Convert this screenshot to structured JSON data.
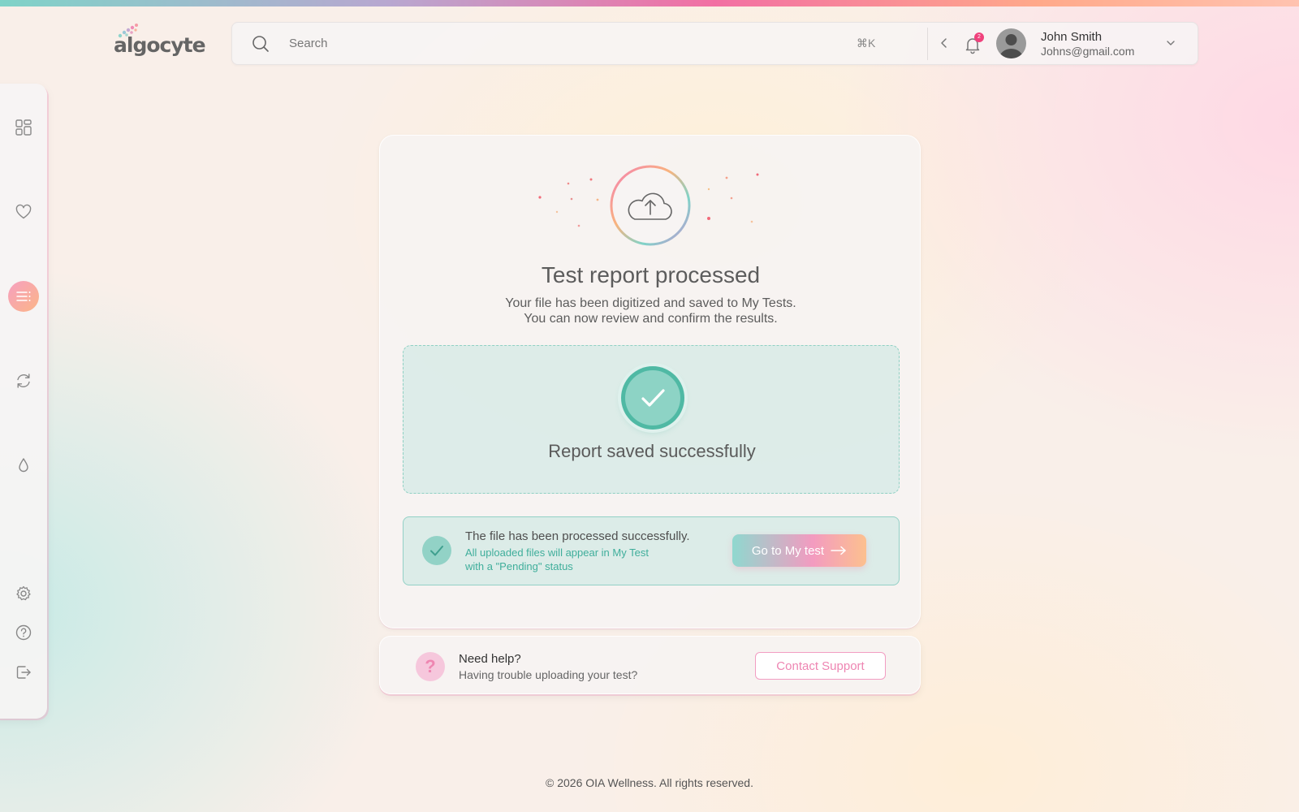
{
  "brand": {
    "name": "algocyte",
    "colors": {
      "teal": "#4fb9a4",
      "pink": "#f26fa3",
      "peach": "#fbb587"
    }
  },
  "header": {
    "search": {
      "placeholder": "Search",
      "shortcut": "⌘K"
    },
    "notifications": {
      "count": "2",
      "icon": "bell-icon"
    },
    "user": {
      "name": "John Smith",
      "email": "Johns@gmail.com"
    }
  },
  "sidebar": {
    "items": [
      {
        "icon": "dashboard-icon",
        "active": false
      },
      {
        "icon": "heart-icon",
        "active": false
      },
      {
        "icon": "tests-list-icon",
        "active": true
      },
      {
        "icon": "refresh-icon",
        "active": false
      },
      {
        "icon": "drop-icon",
        "active": false
      }
    ],
    "bottom_items": [
      {
        "icon": "settings-icon"
      },
      {
        "icon": "help-icon"
      },
      {
        "icon": "logout-icon"
      }
    ]
  },
  "main": {
    "title": "Test report processed",
    "subtitle_line1": "Your file has been digitized and saved to My Tests.",
    "subtitle_line2": "You can now review and confirm the results.",
    "success_message": "Report saved successfully",
    "info": {
      "title": "The file has been processed successfully.",
      "line1": "All uploaded files will appear in My Test",
      "line2": "with a \"Pending\" status",
      "button_label": "Go to My test"
    }
  },
  "help": {
    "title": "Need help?",
    "subtitle": "Having trouble uploading your test?",
    "button_label": "Contact Support"
  },
  "footer": {
    "text": "© 2026 OIA Wellness. All rights reserved."
  }
}
